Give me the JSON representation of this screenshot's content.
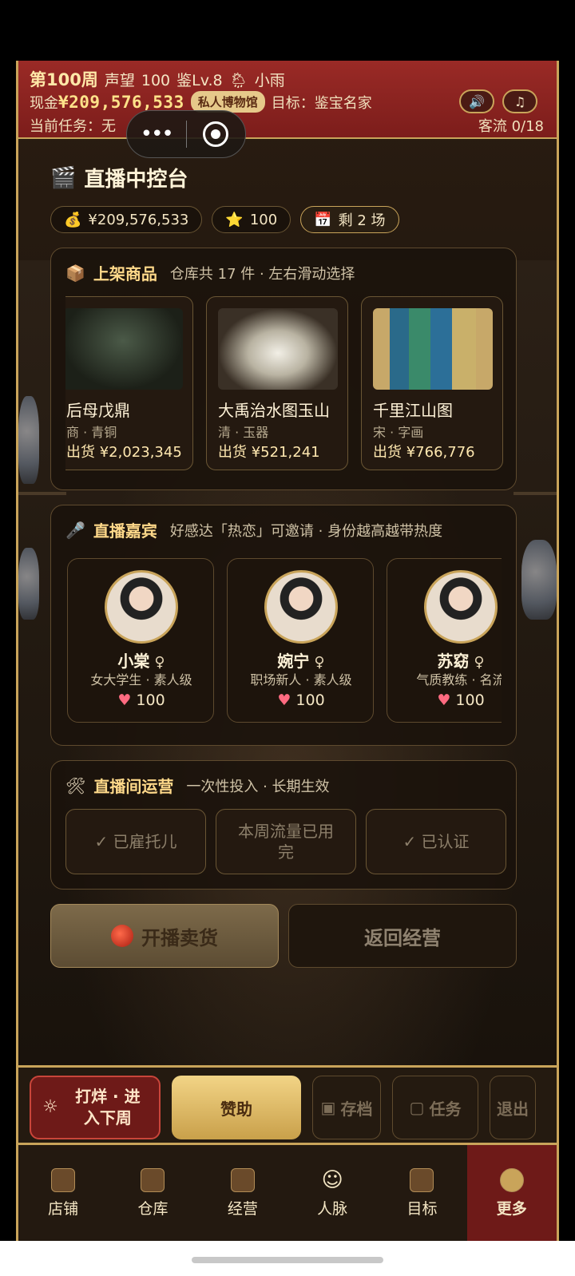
{
  "header": {
    "week": "第100周",
    "fame_label": "声望",
    "fame": "100",
    "appraisal": "鉴Lv.8",
    "weather": "小雨",
    "cash_label": "现金",
    "cash": "¥209,576,533",
    "badge": "私人博物馆",
    "goal": "目标：鉴宝名家",
    "task": "当前任务：无",
    "flow": "客流 0/18"
  },
  "console": {
    "title": "直播中控台",
    "money": "¥209,576,533",
    "stars": "100",
    "remaining": "剩 2 场"
  },
  "goods_panel": {
    "title": "上架商品",
    "sub": "仓库共 17 件 · 左右滑动选择",
    "items": [
      {
        "name": "后母戊鼎",
        "meta": "商 · 青铜",
        "price": "出货 ¥2,023,345"
      },
      {
        "name": "大禹治水图玉山",
        "meta": "清 · 玉器",
        "price": "出货 ¥521,241"
      },
      {
        "name": "千里江山图",
        "meta": "宋 · 字画",
        "price": "出货 ¥766,776"
      }
    ]
  },
  "guest_panel": {
    "title": "直播嘉宾",
    "sub": "好感达「热恋」可邀请 · 身份越高越带热度",
    "guests": [
      {
        "name": "小棠",
        "sex": "♀",
        "role": "女大学生 · 素人级",
        "love": "100"
      },
      {
        "name": "婉宁",
        "sex": "♀",
        "role": "职场新人 · 素人级",
        "love": "100"
      },
      {
        "name": "苏窈",
        "sex": "♀",
        "role": "气质教练 · 名流",
        "love": "100"
      }
    ]
  },
  "ops_panel": {
    "title": "直播间运营",
    "sub": "一次性投入 · 长期生效",
    "ops": [
      "✓ 已雇托儿",
      "本周流量已用完",
      "✓ 已认证"
    ]
  },
  "buttons": {
    "live": "开播卖货",
    "back": "返回经营"
  },
  "action_bar": {
    "next_week": "打烊 · 进入下周",
    "sponsor": "赞助",
    "save": "存档",
    "task": "任务",
    "exit": "退出"
  },
  "tabs": [
    {
      "label": "店铺",
      "icon": "shop-icon"
    },
    {
      "label": "仓库",
      "icon": "warehouse-icon"
    },
    {
      "label": "经营",
      "icon": "ledger-icon"
    },
    {
      "label": "人脉",
      "icon": "people-icon"
    },
    {
      "label": "目标",
      "icon": "scroll-icon"
    },
    {
      "label": "更多",
      "icon": "more-icon"
    }
  ],
  "colors": {
    "accent_gold": "#c9a45a",
    "header_red": "#8f2522",
    "active_tab": "#6e1a18"
  }
}
